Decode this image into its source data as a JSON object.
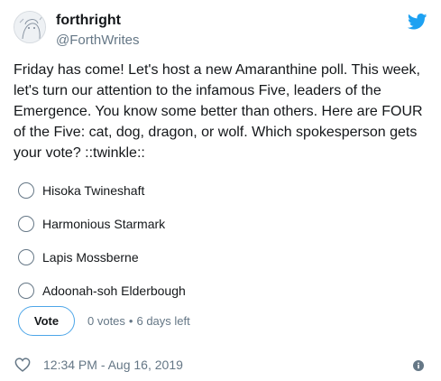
{
  "user": {
    "display_name": "forthright",
    "handle": "@ForthWrites"
  },
  "tweet": {
    "text": "Friday has come! Let's host a new Amaranthine poll. This week, let's turn our attention to the infamous Five, leaders of the Emergence. You know some better than others. Here are FOUR of the Five: cat, dog, dragon, or wolf. Which spokesperson gets your vote? ::twinkle::"
  },
  "poll": {
    "options": [
      {
        "label": "Hisoka Twineshaft"
      },
      {
        "label": "Harmonious Starmark"
      },
      {
        "label": "Lapis Mossberne"
      },
      {
        "label": "Adoonah-soh Elderbough"
      }
    ],
    "vote_label": "Vote",
    "votes_text": "0 votes",
    "separator": "•",
    "time_left": "6 days left"
  },
  "footer": {
    "timestamp": "12:34 PM - Aug 16, 2019"
  },
  "colors": {
    "accent": "#1da1f2",
    "text": "#14171a",
    "muted": "#657786"
  },
  "icons": [
    "avatar-sketch",
    "twitter-bird-icon",
    "heart-icon",
    "info-icon"
  ]
}
